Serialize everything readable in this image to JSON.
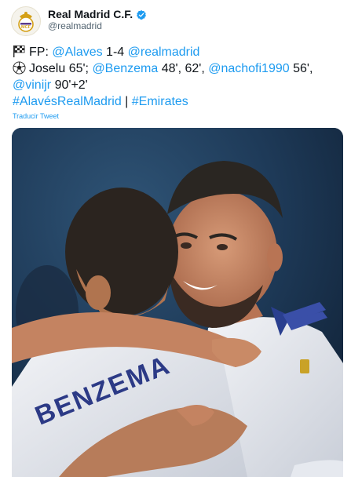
{
  "author": {
    "display_name": "Real Madrid C.F.",
    "handle": "@realmadrid",
    "avatar_icon": "real-madrid-crest-icon",
    "verified_icon": "verified-badge-icon"
  },
  "tweet": {
    "line1": {
      "prefix": "FP: ",
      "team1": "@Alaves",
      "score": " 1-4 ",
      "team2": "@realmadrid"
    },
    "line2": {
      "scorer1": "Joselu 65'; ",
      "mention1": "@Benzema",
      "scorer2_mins": " 48', 62', ",
      "mention2": "@nachofi1990",
      "scorer3_mins": " 56',"
    },
    "line3": {
      "mention3": "@vinijr",
      "scorer4_mins": " 90'+2'"
    },
    "line4": {
      "hashtag1": "#AlavésRealMadrid",
      "separator": " | ",
      "hashtag2": "#Emirates"
    },
    "translate_label": "Traducir Tweet"
  },
  "media": {
    "jersey_name": "BENZEMA"
  },
  "colors": {
    "link": "#1d9bf0",
    "text": "#0f1419",
    "muted": "#536471",
    "verified": "#1d9bf0"
  }
}
